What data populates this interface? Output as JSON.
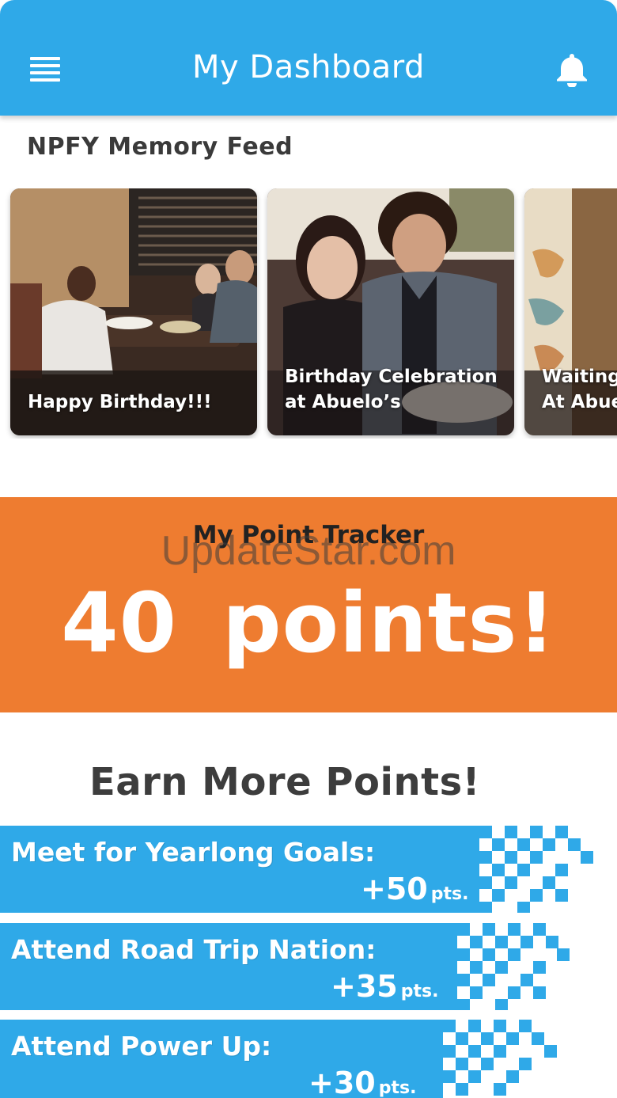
{
  "header": {
    "title": "My Dashboard",
    "menu_icon": "hamburger-menu-icon",
    "notification_icon": "bell-icon",
    "background_color": "#2fa9e8"
  },
  "memory_feed": {
    "title": "NPFY Memory Feed",
    "cards": [
      {
        "caption": "Happy Birthday!!!"
      },
      {
        "caption": "Birthday Celebration\nat Abuelo’s"
      },
      {
        "caption": "Waiting\nAt Abue"
      }
    ]
  },
  "point_tracker": {
    "label": "My Point Tracker",
    "value": "40  points!",
    "background_color": "#ee7c30"
  },
  "watermark": "UpdateStar.com",
  "earn_points": {
    "title": "Earn More Points!",
    "items": [
      {
        "label": "Meet for Yearlong Goals:",
        "points": "+50",
        "unit": "pts."
      },
      {
        "label": "Attend Road Trip Nation:",
        "points": "+35",
        "unit": "pts."
      },
      {
        "label": "Attend Power Up:",
        "points": "+30",
        "unit": "pts."
      }
    ]
  }
}
